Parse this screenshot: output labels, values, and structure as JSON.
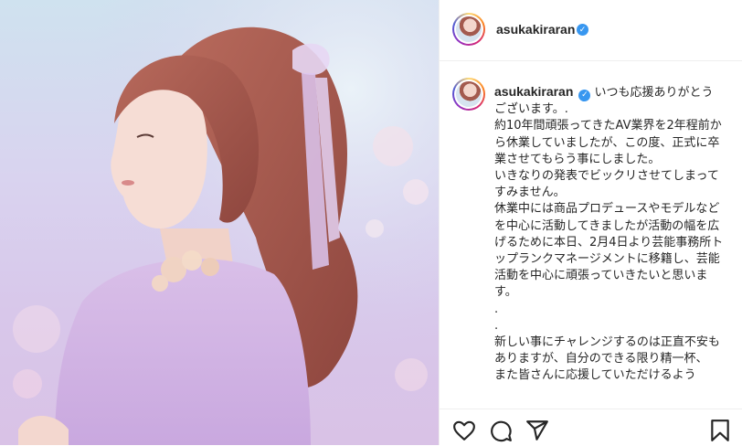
{
  "post": {
    "username": "asukakiraran",
    "caption": "いつも応援ありがとうございます。.\n約10年間頑張ってきたAV業界を2年程前から休業していましたが、この度、正式に卒業させてもらう事にしました。\nいきなりの発表でビックリさせてしまってすみません。\n休業中には商品プロデュースやモデルなどを中心に活動してきましたが活動の幅を広げるために本日、2月4日より芸能事務所トップランクマネージメントに移籍し、芸能活動を中心に頑張っていきたいと思います。\n.\n.\n新しい事にチャレンジするのは正直不安もありますが、自分のできる限り精一杯、\nまた皆さんに応援していただけるよう"
  },
  "icons": {
    "like": "heart-icon",
    "comment": "comment-icon",
    "share": "share-icon",
    "save": "bookmark-icon",
    "verified": "verified-badge-icon"
  },
  "colors": {
    "verified": "#3897f0",
    "text": "#262626",
    "divider": "#efefef"
  }
}
